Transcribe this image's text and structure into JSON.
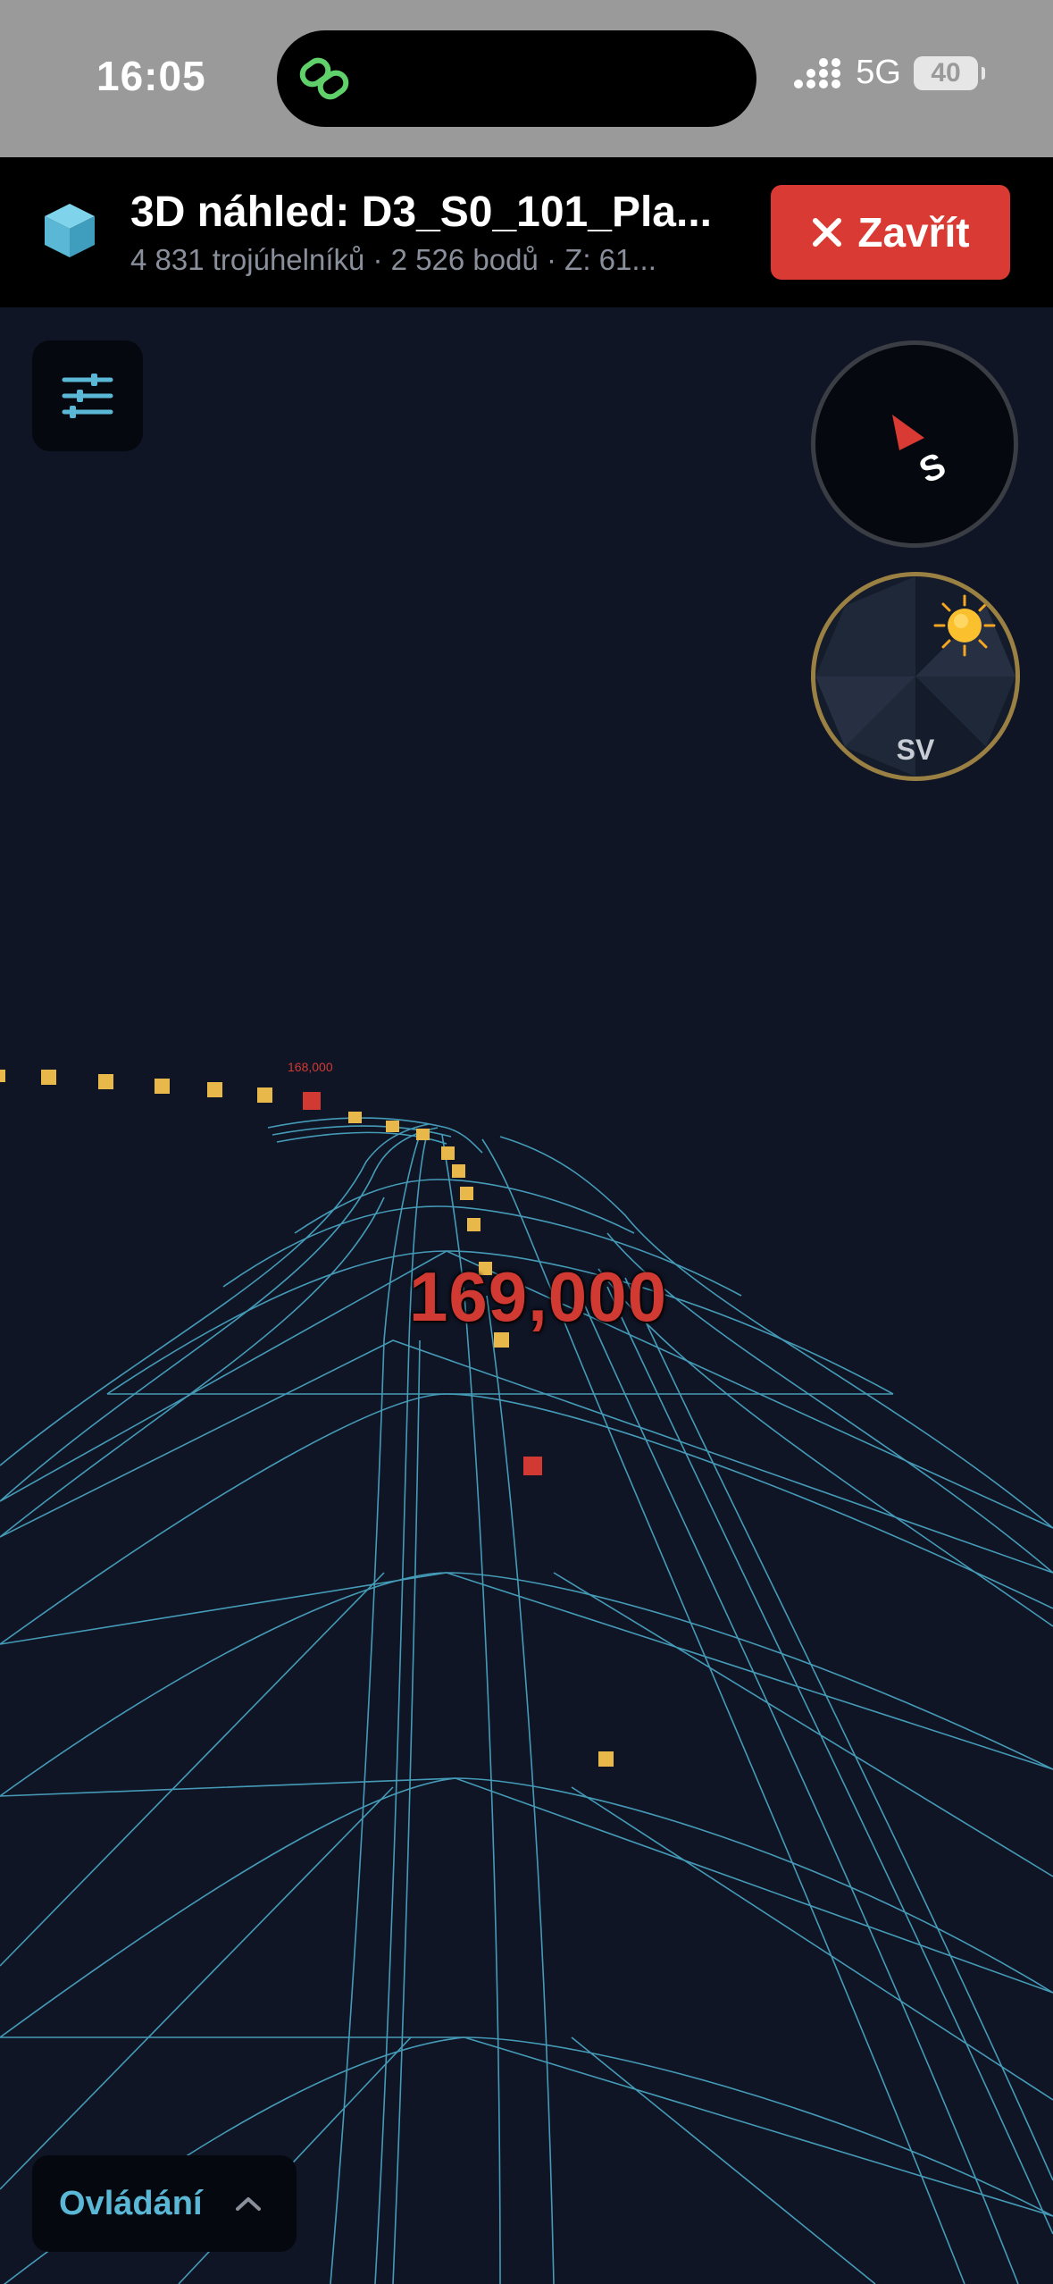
{
  "status": {
    "time": "16:05",
    "network": "5G",
    "battery": "40"
  },
  "header": {
    "title": "3D náhled: D3_S0_101_Pla...",
    "subtitle": "4 831 trojúhelníků · 2 526 bodů · Z: 61...",
    "close_label": "Zavřít"
  },
  "scene": {
    "compass_letter": "S",
    "sun_direction": "SV",
    "station_current": "169,000",
    "station_previous": "168,000"
  },
  "controls": {
    "label": "Ovládání"
  },
  "colors": {
    "accent": "#5ab8d6",
    "mesh": "#4fb3d1",
    "danger": "#d93a33",
    "marker_yellow": "#e9b84a",
    "marker_red": "#d13a32"
  }
}
